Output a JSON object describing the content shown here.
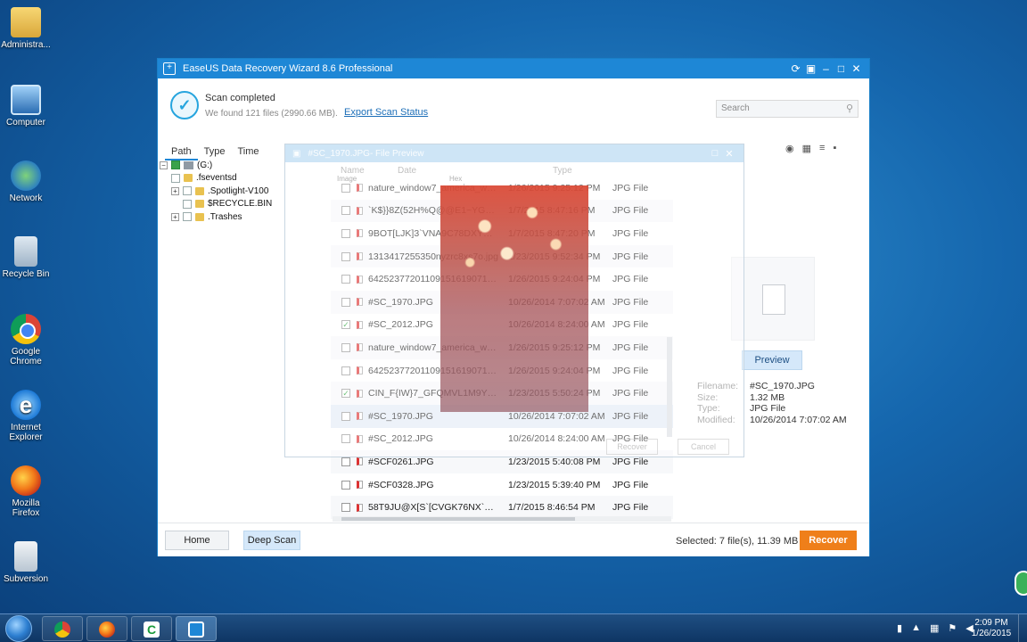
{
  "desktop": {
    "icons": [
      {
        "label": "Administra..."
      },
      {
        "label": "Computer"
      },
      {
        "label": "Network"
      },
      {
        "label": "Recycle Bin"
      },
      {
        "label": "Google Chrome"
      },
      {
        "label": "Internet Explorer"
      },
      {
        "label": "Mozilla Firefox"
      },
      {
        "label": "Subversion"
      }
    ]
  },
  "window": {
    "title": "EaseUS Data Recovery Wizard 8.6 Professional",
    "scan_status": "Scan completed",
    "scan_summary": "We found 121 files (2990.66 MB).",
    "export_link": "Export Scan Status",
    "search_placeholder": "Search",
    "tabs": [
      "Path",
      "Type",
      "Time"
    ],
    "tree": [
      {
        "label": "(G:)"
      },
      {
        "label": ".fseventsd"
      },
      {
        "label": ".Spotlight-V100"
      },
      {
        "label": "$RECYCLE.BIN"
      },
      {
        "label": ".Trashes"
      }
    ],
    "columns": {
      "name": "Name",
      "date": "Date",
      "type": "Type"
    },
    "files": [
      {
        "name": "nature_window7_america_wall...",
        "date": "1/26/2015 9:25:12 PM",
        "type": "JPG File",
        "checked": false
      },
      {
        "name": "`K$}}8Z(52H%Q@@E1~YG72...",
        "date": "1/7/2015 8:47:16 PM",
        "type": "JPG File",
        "checked": false
      },
      {
        "name": "9BOT[LJK]3`VNA9C78DXYR1...",
        "date": "1/7/2015 8:47:20 PM",
        "type": "JPG File",
        "checked": false
      },
      {
        "name": "1313417255350nyzrc8xs7o.jpg",
        "date": "1/23/2015 9:52:34 PM",
        "type": "JPG File",
        "checked": false
      },
      {
        "name": "6425237720110915161907141...",
        "date": "1/26/2015 9:24:04 PM",
        "type": "JPG File",
        "checked": false
      },
      {
        "name": "#SC_1970.JPG",
        "date": "10/26/2014 7:07:02 AM",
        "type": "JPG File",
        "checked": false
      },
      {
        "name": "#SC_2012.JPG",
        "date": "10/26/2014 8:24:00 AM",
        "type": "JPG File",
        "checked": true
      },
      {
        "name": "nature_window7_america_wall...",
        "date": "1/26/2015 9:25:12 PM",
        "type": "JPG File",
        "checked": false
      },
      {
        "name": "6425237720110915161907141...",
        "date": "1/26/2015 9:24:04 PM",
        "type": "JPG File",
        "checked": false
      },
      {
        "name": "CIN_F{IW}7_GFQMVL1M9YX...",
        "date": "1/23/2015 5:50:24 PM",
        "type": "JPG File",
        "checked": true
      },
      {
        "name": "#SC_1970.JPG",
        "date": "10/26/2014 7:07:02 AM",
        "type": "JPG File",
        "checked": false
      },
      {
        "name": "#SC_2012.JPG",
        "date": "10/26/2014 8:24:00 AM",
        "type": "JPG File",
        "checked": false
      },
      {
        "name": "#SCF0261.JPG",
        "date": "1/23/2015 5:40:08 PM",
        "type": "JPG File",
        "checked": false
      },
      {
        "name": "#SCF0328.JPG",
        "date": "1/23/2015 5:39:40 PM",
        "type": "JPG File",
        "checked": false
      },
      {
        "name": "58T9JU@X[S`[CVGK76NX`Q.j...",
        "date": "1/7/2015 8:46:54 PM",
        "type": "JPG File",
        "checked": false
      }
    ],
    "preview_button": "Preview",
    "info": [
      {
        "label": "Filename:",
        "value": "#SC_1970.JPG"
      },
      {
        "label": "Size:",
        "value": "1.32 MB"
      },
      {
        "label": "Type:",
        "value": "JPG File"
      },
      {
        "label": "Modified:",
        "value": "10/26/2014 7:07:02 AM"
      }
    ],
    "preview_dialog": {
      "title": "#SC_1970.JPG- File Preview",
      "image_label": "Image",
      "hex_label": "Hex",
      "recover": "Recover",
      "cancel": "Cancel"
    },
    "bottom": {
      "home": "Home",
      "deep_scan": "Deep Scan",
      "selected": "Selected: 7 file(s), 11.39 MB",
      "recover": "Recover"
    }
  },
  "taskbar": {
    "time": "2:09 PM",
    "date": "1/26/2015"
  },
  "colors": {
    "accent": "#1e87d6",
    "recover": "#ef7f1a"
  }
}
